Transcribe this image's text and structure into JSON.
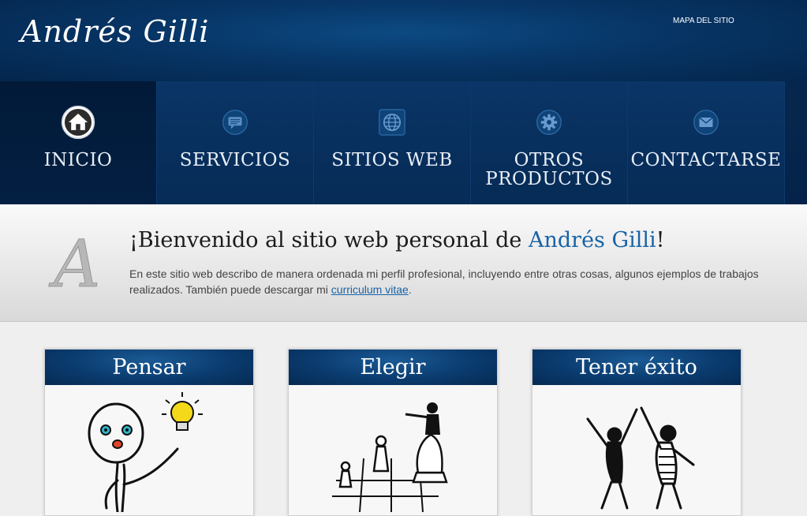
{
  "header": {
    "logo": "Andrés Gilli",
    "sitemap_link": "MAPA DEL SITIO"
  },
  "nav": {
    "items": [
      {
        "label": "INICIO",
        "icon": "home-icon",
        "active": true
      },
      {
        "label": "SERVICIOS",
        "icon": "chat-icon"
      },
      {
        "label": "SITIOS WEB",
        "icon": "globe-icon"
      },
      {
        "label": "OTROS\nPRODUCTOS",
        "icon": "gear-icon"
      },
      {
        "label": "CONTACTARSE",
        "icon": "envelope-icon"
      }
    ]
  },
  "welcome": {
    "monogram": "A",
    "title_prefix": "¡Bienvenido al sitio web personal de ",
    "title_name": "Andrés Gilli",
    "title_suffix": "!",
    "text_before_link": "En este sitio web describo de manera ordenada mi perfil profesional, incluyendo entre otras cosas, algunos ejemplos de trabajos realizados. También puede descargar mi ",
    "link": "curriculum vitae",
    "text_after_link": "."
  },
  "cards": [
    {
      "title": "Pensar",
      "art": "thinking-figure-illustration"
    },
    {
      "title": "Elegir",
      "art": "chess-pieces-illustration"
    },
    {
      "title": "Tener éxito",
      "art": "celebrating-figures-illustration"
    }
  ],
  "colors": {
    "header_blue": "#073566",
    "nav_blue": "#06274d",
    "link_blue": "#1863a8"
  }
}
